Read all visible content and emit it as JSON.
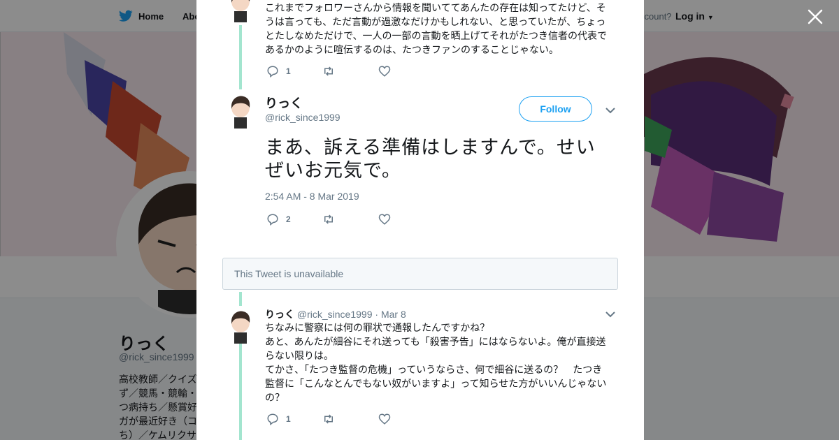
{
  "nav": {
    "home_label": "Home",
    "about_label": "Abo",
    "account_prompt": "ccount?",
    "login_label": "Log in"
  },
  "profile": {
    "name": "りっく",
    "handle": "@rick_since1999",
    "bio_lines": [
      "高校教師／クイズ",
      "ず／競馬・競輪・",
      "つ病持ち／懸賞好",
      "ガが最近好き（コ",
      "ち）／ケムリクサ"
    ]
  },
  "thread": {
    "prev_tweet": {
      "text": "これまでフォロワーさんから情報を聞いててあんたの存在は知ってたけど、そうは言っても、ただ言動が過激なだけかもしれない、と思っていたが、ちょっとたしなめただけで、一人の一部の言動を晒上げてそれがたつき信者の代表であるかのように喧伝するのは、たつきファンのすることじゃない。",
      "replies": "1"
    },
    "main_tweet": {
      "name": "りっく",
      "handle": "@rick_since1999",
      "follow_label": "Follow",
      "text": "まあ、訴える準備はしますんで。せいぜいお元気で。",
      "timestamp": "2:54 AM - 8 Mar 2019",
      "replies": "2"
    },
    "unavailable_text": "This Tweet is unavailable",
    "reply_tweet": {
      "name": "りっく",
      "handle": "@rick_since1999",
      "date": "· Mar 8",
      "text_lines": [
        "ちなみに警察には何の罪状で通報したんですかね？",
        "あと、あんたが細谷にそれ送っても「殺害予告」にはならないよ。俺が直接送らない限りは。",
        "てかさ、「たつき監督の危機」っていうならさ、何で細谷に送るの？　たつき監督に「こんなとんでもない奴がいますよ」って知らせた方がいいんじゃないの？"
      ],
      "replies": "1"
    }
  },
  "colors": {
    "brand": "#1da1f2",
    "thread_line": "#a3e5cf",
    "text": "#14171a",
    "muted": "#657786"
  },
  "icons": [
    "twitter-bird-icon",
    "close-icon",
    "reply-icon",
    "retweet-icon",
    "like-icon",
    "chevron-down-icon"
  ]
}
